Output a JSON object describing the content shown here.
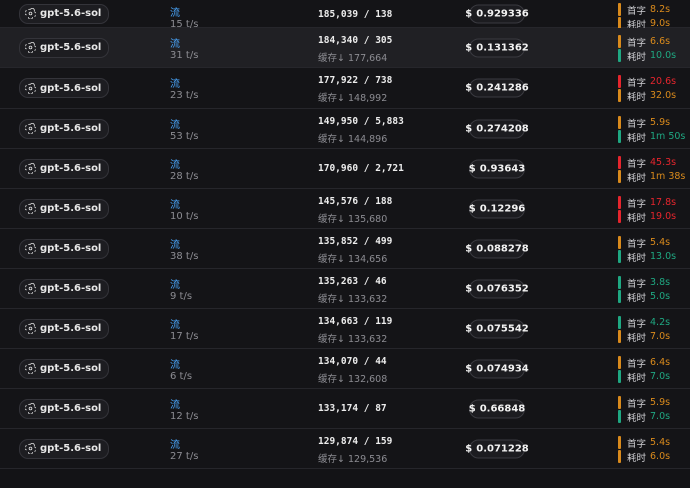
{
  "colors": {
    "orange": "#d98a1c",
    "green": "#1fa882",
    "red": "#e5252d",
    "stream_blue": "#4aa8ff"
  },
  "labels": {
    "first_token": "首字",
    "total_time": "耗时",
    "currency": "$"
  },
  "rows": [
    {
      "model": "gpt-5.6-sol",
      "stream": "流",
      "speed": "15 t/s",
      "tokens": "185,039 / 138",
      "cache": "",
      "cost": "0.929336",
      "first_token": "8.2s",
      "first_color": "orange",
      "total_time": "9.0s",
      "total_color": "orange"
    },
    {
      "model": "gpt-5.6-sol",
      "stream": "流",
      "speed": "31 t/s",
      "tokens": "184,340 / 305",
      "cache": "缓存↓ 177,664",
      "cost": "0.131362",
      "first_token": "6.6s",
      "first_color": "orange",
      "total_time": "10.0s",
      "total_color": "green"
    },
    {
      "model": "gpt-5.6-sol",
      "stream": "流",
      "speed": "23 t/s",
      "tokens": "177,922 / 738",
      "cache": "缓存↓ 148,992",
      "cost": "0.241286",
      "first_token": "20.6s",
      "first_color": "red",
      "total_time": "32.0s",
      "total_color": "orange"
    },
    {
      "model": "gpt-5.6-sol",
      "stream": "流",
      "speed": "53 t/s",
      "tokens": "149,950 / 5,883",
      "cache": "缓存↓ 144,896",
      "cost": "0.274208",
      "first_token": "5.9s",
      "first_color": "orange",
      "total_time": "1m 50s",
      "total_color": "green"
    },
    {
      "model": "gpt-5.6-sol",
      "stream": "流",
      "speed": "28 t/s",
      "tokens": "170,960 / 2,721",
      "cache": "",
      "cost": "0.93643",
      "first_token": "45.3s",
      "first_color": "red",
      "total_time": "1m 38s",
      "total_color": "orange"
    },
    {
      "model": "gpt-5.6-sol",
      "stream": "流",
      "speed": "10 t/s",
      "tokens": "145,576 / 188",
      "cache": "缓存↓ 135,680",
      "cost": "0.12296",
      "first_token": "17.8s",
      "first_color": "red",
      "total_time": "19.0s",
      "total_color": "red"
    },
    {
      "model": "gpt-5.6-sol",
      "stream": "流",
      "speed": "38 t/s",
      "tokens": "135,852 / 499",
      "cache": "缓存↓ 134,656",
      "cost": "0.088278",
      "first_token": "5.4s",
      "first_color": "orange",
      "total_time": "13.0s",
      "total_color": "green"
    },
    {
      "model": "gpt-5.6-sol",
      "stream": "流",
      "speed": "9 t/s",
      "tokens": "135,263 / 46",
      "cache": "缓存↓ 133,632",
      "cost": "0.076352",
      "first_token": "3.8s",
      "first_color": "green",
      "total_time": "5.0s",
      "total_color": "green"
    },
    {
      "model": "gpt-5.6-sol",
      "stream": "流",
      "speed": "17 t/s",
      "tokens": "134,663 / 119",
      "cache": "缓存↓ 133,632",
      "cost": "0.075542",
      "first_token": "4.2s",
      "first_color": "green",
      "total_time": "7.0s",
      "total_color": "orange"
    },
    {
      "model": "gpt-5.6-sol",
      "stream": "流",
      "speed": "6 t/s",
      "tokens": "134,070 / 44",
      "cache": "缓存↓ 132,608",
      "cost": "0.074934",
      "first_token": "6.4s",
      "first_color": "orange",
      "total_time": "7.0s",
      "total_color": "green"
    },
    {
      "model": "gpt-5.6-sol",
      "stream": "流",
      "speed": "12 t/s",
      "tokens": "133,174 / 87",
      "cache": "",
      "cost": "0.66848",
      "first_token": "5.9s",
      "first_color": "orange",
      "total_time": "7.0s",
      "total_color": "green"
    },
    {
      "model": "gpt-5.6-sol",
      "stream": "流",
      "speed": "27 t/s",
      "tokens": "129,874 / 159",
      "cache": "缓存↓ 129,536",
      "cost": "0.071228",
      "first_token": "5.4s",
      "first_color": "orange",
      "total_time": "6.0s",
      "total_color": "orange"
    }
  ]
}
